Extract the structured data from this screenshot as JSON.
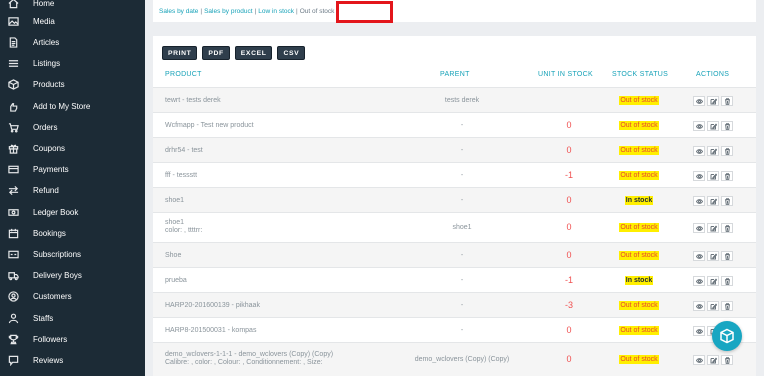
{
  "sidebar": {
    "items": [
      {
        "label": "Home",
        "icon": "home-icon"
      },
      {
        "label": "Media",
        "icon": "image-icon"
      },
      {
        "label": "Articles",
        "icon": "document-icon"
      },
      {
        "label": "Listings",
        "icon": "list-icon"
      },
      {
        "label": "Products",
        "icon": "cube-icon"
      },
      {
        "label": "Add to My Store",
        "icon": "hand-icon"
      },
      {
        "label": "Orders",
        "icon": "cart-icon"
      },
      {
        "label": "Coupons",
        "icon": "gift-icon"
      },
      {
        "label": "Payments",
        "icon": "credit-card-icon"
      },
      {
        "label": "Refund",
        "icon": "refund-icon"
      },
      {
        "label": "Ledger Book",
        "icon": "money-icon"
      },
      {
        "label": "Bookings",
        "icon": "calendar-icon"
      },
      {
        "label": "Subscriptions",
        "icon": "subscription-icon"
      },
      {
        "label": "Delivery Boys",
        "icon": "truck-icon"
      },
      {
        "label": "Customers",
        "icon": "user-circle-icon"
      },
      {
        "label": "Staffs",
        "icon": "user-icon"
      },
      {
        "label": "Followers",
        "icon": "trophy-icon"
      },
      {
        "label": "Reviews",
        "icon": "comment-icon"
      }
    ]
  },
  "breadcrumb": {
    "by_date": "Sales by date",
    "by_product": "Sales by product",
    "low_stock": "Low in stock",
    "out_of_stock": "Out of stock",
    "separator": "|"
  },
  "export_buttons": [
    "PRINT",
    "PDF",
    "EXCEL",
    "CSV"
  ],
  "table": {
    "headers": {
      "product": "PRODUCT",
      "parent": "PARENT",
      "unit": "UNIT IN STOCK",
      "status": "STOCK STATUS",
      "actions": "ACTIONS"
    },
    "rows": [
      {
        "product": "tewrt - tests derek",
        "sub": "",
        "parent": "tests derek",
        "unit": "",
        "status": "Out of stock",
        "status_type": "out"
      },
      {
        "product": "Wcfmapp - Test new product",
        "sub": "",
        "parent": "-",
        "unit": "0",
        "status": "Out of stock",
        "status_type": "out"
      },
      {
        "product": "drhr54 - test",
        "sub": "",
        "parent": "-",
        "unit": "0",
        "status": "Out of stock",
        "status_type": "out"
      },
      {
        "product": "fff - tessstt",
        "sub": "",
        "parent": "-",
        "unit": "-1",
        "status": "Out of stock",
        "status_type": "out"
      },
      {
        "product": "shoe1",
        "sub": "",
        "parent": "-",
        "unit": "0",
        "status": "In stock",
        "status_type": "in"
      },
      {
        "product": "shoe1",
        "sub": "color: , ttttrr:",
        "parent": "shoe1",
        "unit": "0",
        "status": "Out of stock",
        "status_type": "out"
      },
      {
        "product": "Shoe",
        "sub": "",
        "parent": "-",
        "unit": "0",
        "status": "Out of stock",
        "status_type": "out"
      },
      {
        "product": "prueba",
        "sub": "",
        "parent": "-",
        "unit": "-1",
        "status": "In stock",
        "status_type": "in"
      },
      {
        "product": "HARP20-201600139 - pikhaak",
        "sub": "",
        "parent": "-",
        "unit": "-3",
        "status": "Out of stock",
        "status_type": "out"
      },
      {
        "product": "HARP8-201500031 - kompas",
        "sub": "",
        "parent": "-",
        "unit": "0",
        "status": "Out of stock",
        "status_type": "out"
      },
      {
        "product": "demo_wclovers-1-1-1 - demo_wclovers (Copy) (Copy)",
        "sub": "Calibre: , color: , Colour: , Conditionnement: , Size:",
        "parent": "demo_wclovers (Copy) (Copy)",
        "unit": "0",
        "status": "Out of stock",
        "status_type": "out"
      }
    ],
    "action_icons": [
      "eye-icon",
      "edit-icon",
      "trash-icon"
    ]
  },
  "colors": {
    "sidebar_bg": "#1c2b36",
    "accent": "#17a2b8",
    "stock_red": "#f05050",
    "badge_yellow": "#ffef00",
    "highlight_red": "#e3161b"
  }
}
